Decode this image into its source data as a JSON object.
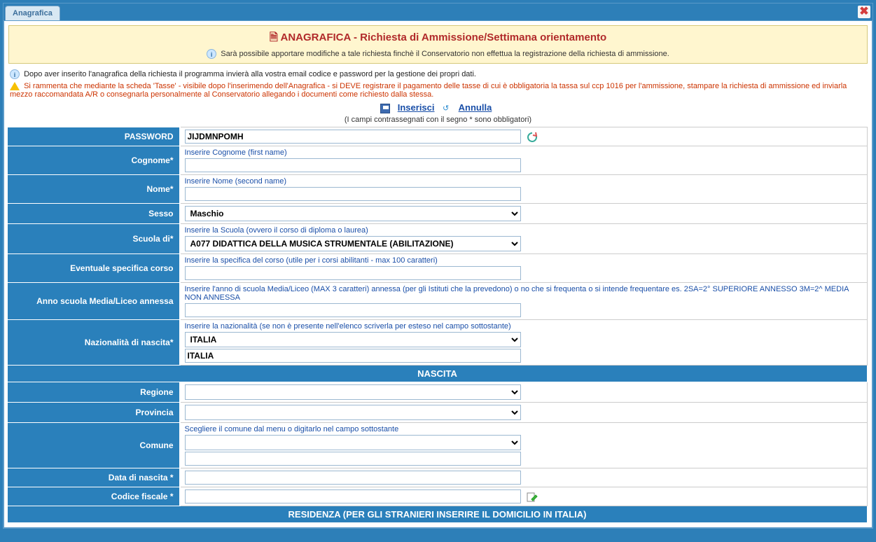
{
  "tab": {
    "label": "Anagrafica"
  },
  "header": {
    "title": "ANAGRAFICA - Richiesta di Ammissione/Settimana orientamento",
    "subtitle": "Sarà possibile apportare modifiche a tale richiesta finchè il Conservatorio non effettua la registrazione della richiesta di ammissione."
  },
  "info_line": "Dopo aver inserito l'anagrafica della richiesta il programma invierà alla vostra email codice e password per la gestione dei propri dati.",
  "warn_line": "Si rammenta che mediante la scheda 'Tasse' - visibile dopo l'inserimendo dell'Anagrafica - si DEVE registrare il pagamento delle tasse di cui è obbligatoria la tassa sul ccp 1016 per l'ammissione, stampare la richiesta di ammissione ed inviarla mezzo raccomandata A/R o consegnarla personalmente al Conservatorio allegando i documenti come richiesto dalla stessa.",
  "actions": {
    "inserisci": "Inserisci",
    "annulla": "Annulla",
    "note": "(I campi contrassegnati con il segno * sono obbligatori)"
  },
  "fields": {
    "password": {
      "label": "PASSWORD",
      "value": "JIJDMNPOMH"
    },
    "cognome": {
      "label": "Cognome*",
      "hint": "Inserire Cognome (first name)",
      "value": ""
    },
    "nome": {
      "label": "Nome*",
      "hint": "Inserire Nome (second name)",
      "value": ""
    },
    "sesso": {
      "label": "Sesso",
      "value": "Maschio"
    },
    "scuola": {
      "label": "Scuola di*",
      "hint": "Inserire la Scuola (ovvero il corso di diploma o laurea)",
      "value": "A077 DIDATTICA DELLA MUSICA STRUMENTALE (ABILITAZIONE)"
    },
    "specifica": {
      "label": "Eventuale specifica corso",
      "hint": "Inserire la specifica del corso (utile per i corsi abilitanti - max 100 caratteri)",
      "value": ""
    },
    "anno_media": {
      "label": "Anno scuola Media/Liceo annessa",
      "hint": "Inserire l'anno di scuola Media/Liceo (MAX 3 caratteri) annessa (per gli Istituti che la prevedono) o no che si frequenta o si intende frequentare es. 2SA=2° SUPERIORE ANNESSO 3M=2^ MEDIA NON ANNESSA",
      "value": ""
    },
    "nazionalita": {
      "label": "Nazionalità di nascita*",
      "hint": "Inserire la nazionalità (se non è presente nell'elenco scriverla per esteso nel campo sottostante)",
      "select_value": "ITALIA",
      "text_value": "ITALIA"
    },
    "nascita_header": "NASCITA",
    "regione": {
      "label": "Regione",
      "value": ""
    },
    "provincia": {
      "label": "Provincia",
      "value": ""
    },
    "comune": {
      "label": "Comune",
      "hint": "Scegliere il comune dal menu o digitarlo nel campo sottostante",
      "select_value": "",
      "text_value": ""
    },
    "data_nascita": {
      "label": "Data di nascita *",
      "value": ""
    },
    "codice_fiscale": {
      "label": "Codice fiscale *",
      "value": ""
    },
    "residenza_header": "RESIDENZA (PER GLI STRANIERI INSERIRE IL DOMICILIO IN ITALIA)"
  }
}
